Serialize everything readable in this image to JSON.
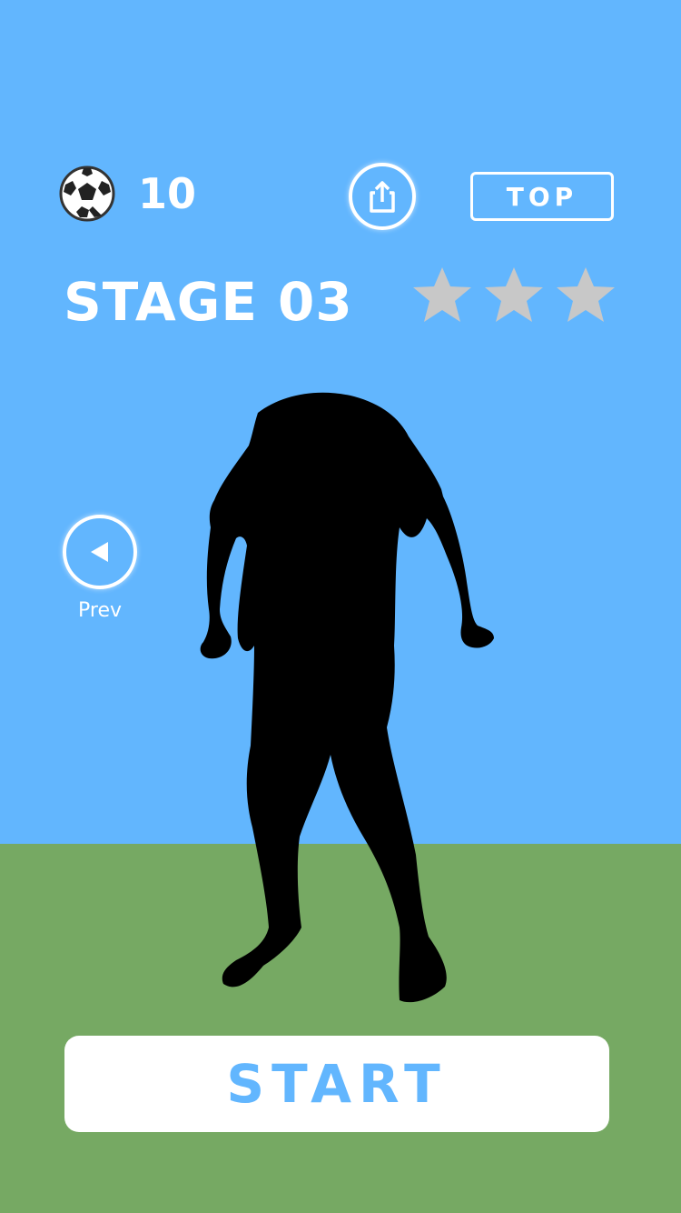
{
  "colors": {
    "sky": "#62b6fe",
    "grass": "#76a963",
    "white": "#ffffff",
    "star_inactive": "#c8c8c8",
    "start_text": "#62b6fe"
  },
  "header": {
    "coins": "10",
    "top_label": "TOP"
  },
  "stage": {
    "label": "STAGE",
    "number": "03",
    "stars_earned": 0,
    "stars_total": 3
  },
  "nav": {
    "prev_label": "Prev"
  },
  "actions": {
    "start_label": "START"
  },
  "icons": {
    "ball": "soccer-ball-icon",
    "share": "share-icon",
    "prev": "triangle-left-icon",
    "star": "star-icon"
  }
}
